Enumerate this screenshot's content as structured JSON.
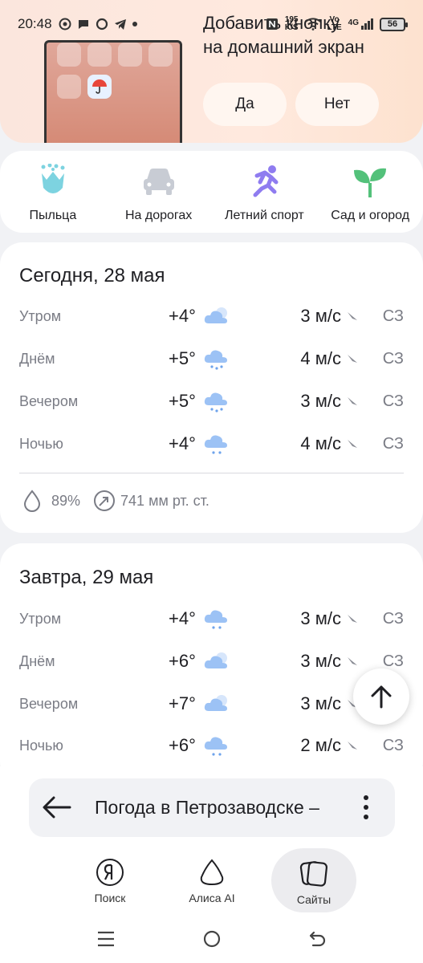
{
  "status_bar": {
    "time": "20:48",
    "speed_value": "195",
    "speed_unit": "K/S",
    "vo": "Vo",
    "lte": "LTE",
    "network": "4G",
    "battery": "56"
  },
  "promo": {
    "title_line1": "Добавить кнопку",
    "title_line2": "на домашний экран",
    "yes_label": "Да",
    "no_label": "Нет"
  },
  "categories": [
    {
      "label": "Пыльца",
      "icon": "flower-icon"
    },
    {
      "label": "На дорогах",
      "icon": "car-icon"
    },
    {
      "label": "Летний спорт",
      "icon": "runner-icon"
    },
    {
      "label": "Сад и огород",
      "icon": "sprout-icon"
    }
  ],
  "today": {
    "title": "Сегодня, 28 мая",
    "rows": [
      {
        "period": "Утром",
        "temp": "+4°",
        "icon": "cloudy-icon",
        "wind": "3 м/с",
        "dir": "СЗ"
      },
      {
        "period": "Днём",
        "temp": "+5°",
        "icon": "rain-icon",
        "wind": "4 м/с",
        "dir": "СЗ"
      },
      {
        "period": "Вечером",
        "temp": "+5°",
        "icon": "rain-icon",
        "wind": "3 м/с",
        "dir": "СЗ"
      },
      {
        "period": "Ночью",
        "temp": "+4°",
        "icon": "rain-icon",
        "wind": "4 м/с",
        "dir": "СЗ"
      }
    ],
    "humidity": "89%",
    "pressure": "741 мм рт. ст."
  },
  "tomorrow": {
    "title": "Завтра, 29 мая",
    "rows": [
      {
        "period": "Утром",
        "temp": "+4°",
        "icon": "rain-icon",
        "wind": "3 м/с",
        "dir": "СЗ"
      },
      {
        "period": "Днём",
        "temp": "+6°",
        "icon": "cloudy-icon",
        "wind": "3 м/с",
        "dir": "СЗ"
      },
      {
        "period": "Вечером",
        "temp": "+7°",
        "icon": "cloudy-icon",
        "wind": "3 м/с",
        "dir": "СЗ"
      },
      {
        "period": "Ночью",
        "temp": "+6°",
        "icon": "rain-icon",
        "wind": "2 м/с",
        "dir": "СЗ"
      }
    ]
  },
  "url_bar": {
    "text": "Погода в Петрозаводске –"
  },
  "bottom_nav": [
    {
      "label": "Поиск"
    },
    {
      "label": "Алиса AI"
    },
    {
      "label": "Сайты"
    }
  ],
  "colors": {
    "accent_purple": "#8f7cf0",
    "plant_green": "#53c17a",
    "flower_teal": "#7dd3e0",
    "weather_blue": "#9cc2f5"
  }
}
